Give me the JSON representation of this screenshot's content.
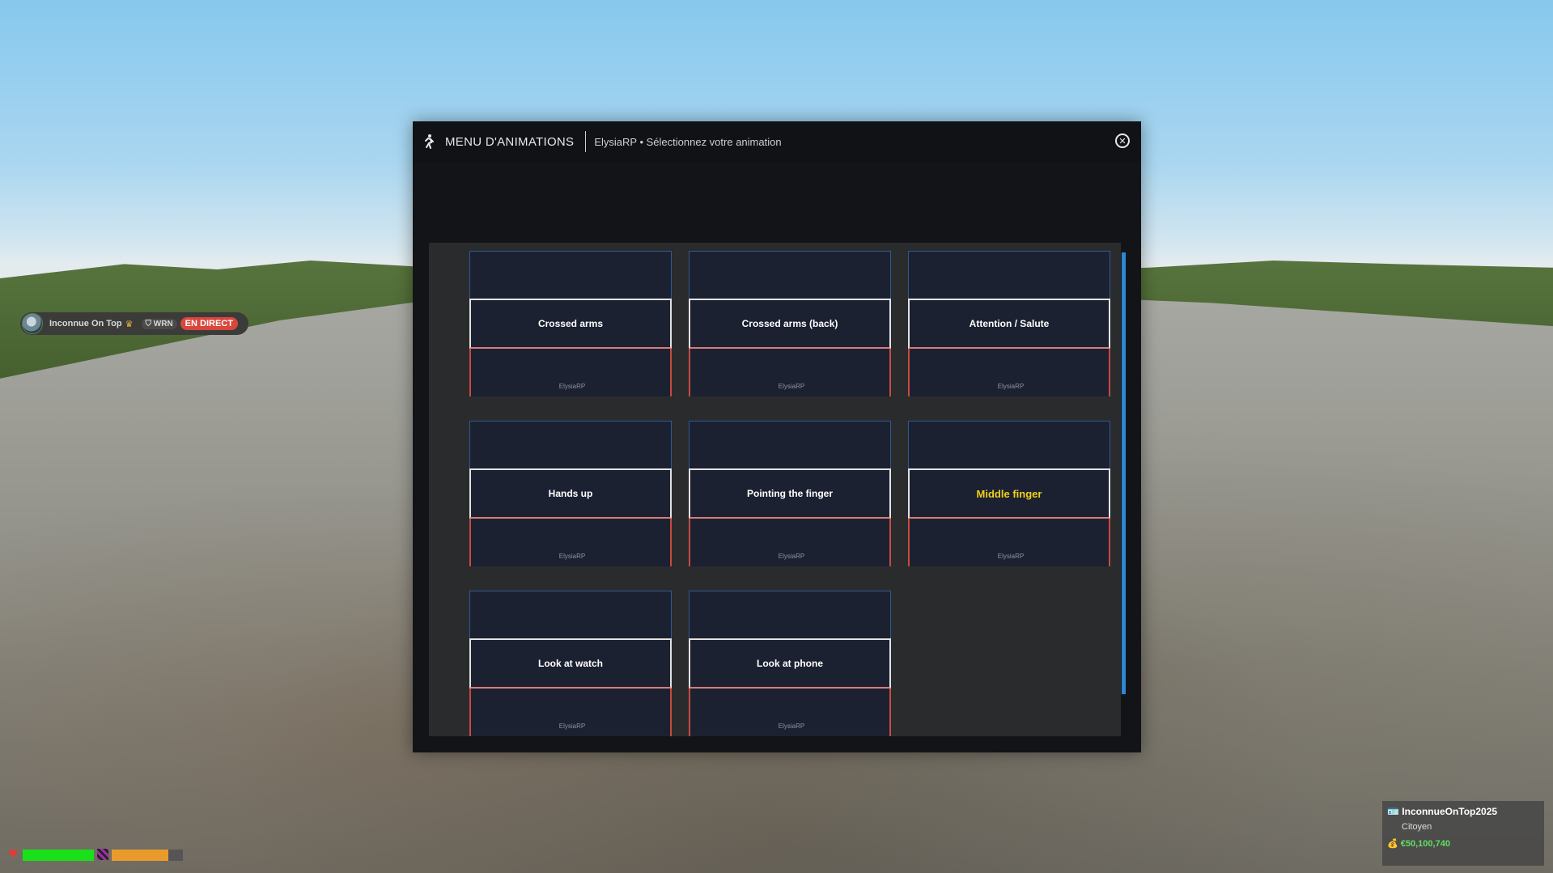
{
  "menu": {
    "title": "MENU D'ANIMATIONS",
    "subtitle": "ElysiaRP • Sélectionnez votre animation",
    "close_icon": "close-circle-icon",
    "brand_label": "ElysiaRP",
    "animations": [
      {
        "label": "Crossed arms",
        "highlighted": false
      },
      {
        "label": "Crossed arms (back)",
        "highlighted": false
      },
      {
        "label": "Attention / Salute",
        "highlighted": false
      },
      {
        "label": "Hands up",
        "highlighted": false
      },
      {
        "label": "Pointing the finger",
        "highlighted": false
      },
      {
        "label": "Middle finger",
        "highlighted": true
      },
      {
        "label": "Look at watch",
        "highlighted": false
      },
      {
        "label": "Look at phone",
        "highlighted": false
      }
    ]
  },
  "hud": {
    "player_badge": {
      "name": "Inconnue On Top",
      "tag": "WRN",
      "live": "EN DIRECT"
    },
    "health": 1.0,
    "armor": 0.8,
    "player_card": {
      "name": "InconnueOnTop2025",
      "role": "Citoyen",
      "money": "€50,100,740"
    }
  },
  "colors": {
    "accent_blue": "#2f87d4",
    "highlight": "#f2cf1a",
    "live_red": "#d8463c",
    "health_green": "#19e019",
    "armor_orange": "#e89b2c"
  }
}
